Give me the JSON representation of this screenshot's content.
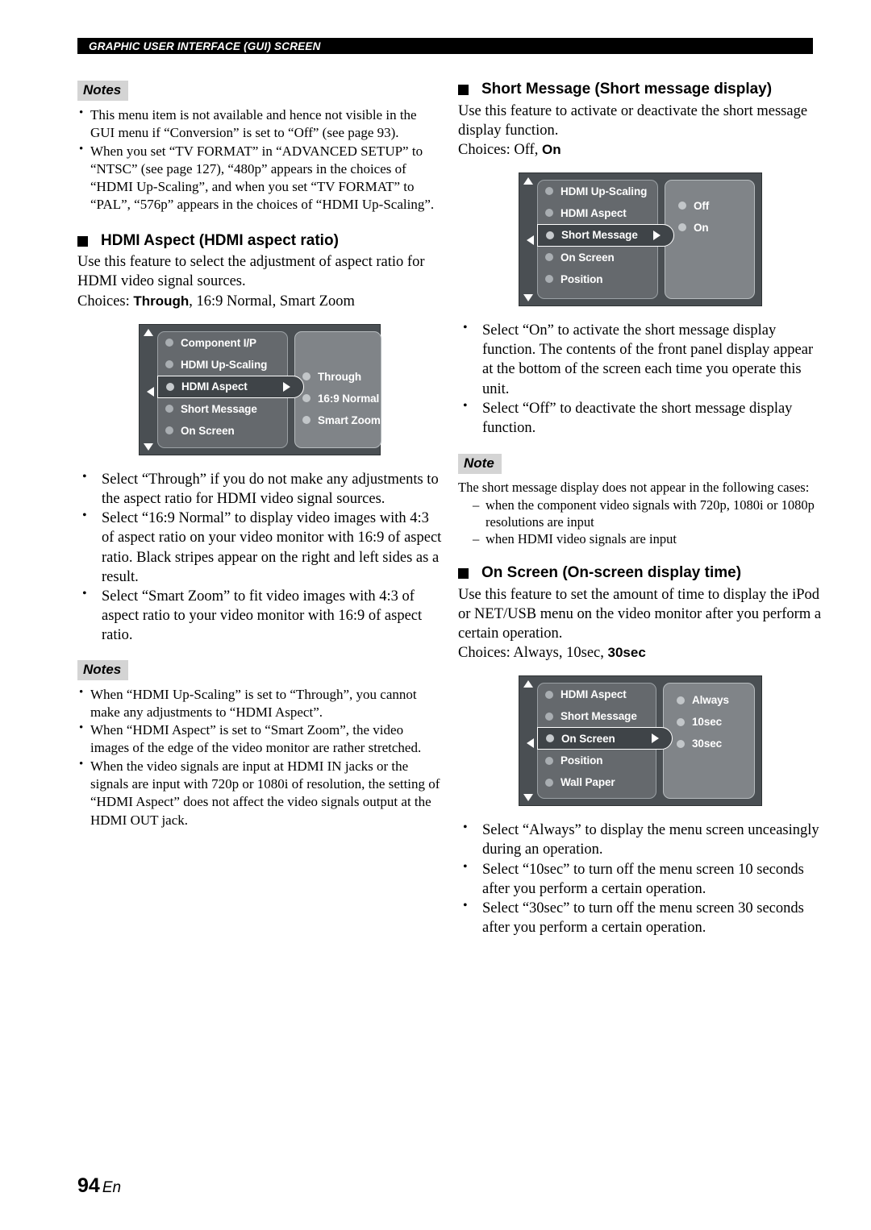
{
  "header": {
    "running_head": "GRAPHIC USER INTERFACE (GUI) SCREEN"
  },
  "footer": {
    "page_number": "94",
    "language": "En"
  },
  "labels": {
    "notes": "Notes",
    "note": "Note"
  },
  "left_column": {
    "notes_1": [
      "This menu item is not available and hence not visible in the GUI menu if “Conversion” is set to “Off” (see page 93).",
      "When you set “TV FORMAT” in “ADVANCED SETUP” to “NTSC” (see page 127), “480p” appears in the choices of “HDMI Up-Scaling”, and when you set “TV FORMAT” to “PAL”, “576p” appears in the choices of “HDMI Up-Scaling”."
    ],
    "section": {
      "heading": "HDMI Aspect (HDMI aspect ratio)",
      "description": "Use this feature to select the adjustment of aspect ratio for HDMI video signal sources.",
      "choices_label": "Choices:",
      "choices_bold": "Through",
      "choices_rest": ", 16:9 Normal, Smart Zoom"
    },
    "menu": {
      "left_items": [
        {
          "label": "Component I/P",
          "selected": false
        },
        {
          "label": "HDMI Up-Scaling",
          "selected": false
        },
        {
          "label": "HDMI Aspect",
          "selected": true
        },
        {
          "label": "Short Message",
          "selected": false
        },
        {
          "label": "On Screen",
          "selected": false
        }
      ],
      "right_items": [
        "Through",
        "16:9 Normal",
        "Smart Zoom"
      ],
      "scroll_up": "▲",
      "scroll_down": "▼"
    },
    "bullets": [
      "Select “Through” if you do not make any adjustments to the aspect ratio for HDMI video signal sources.",
      "Select “16:9 Normal” to display video images with 4:3 of aspect ratio on your video monitor with 16:9 of aspect ratio. Black stripes appear on the right and left sides as a result.",
      "Select “Smart Zoom” to fit video images with 4:3 of aspect ratio to your video monitor with 16:9 of aspect ratio."
    ],
    "notes_2": [
      "When “HDMI Up-Scaling” is set to “Through”, you cannot make any adjustments to “HDMI Aspect”.",
      "When “HDMI Aspect” is set to “Smart Zoom”, the video images of the edge of the video monitor are rather stretched.",
      "When the video signals are input at HDMI IN jacks or the signals are input with 720p or 1080i of resolution, the setting of “HDMI Aspect” does not affect the video signals output at the HDMI OUT jack."
    ]
  },
  "right_column": {
    "section_short_message": {
      "heading": "Short Message (Short message display)",
      "description": "Use this feature to activate or deactivate the short message display function.",
      "choices_label": "Choices: Off, ",
      "choices_bold": "On"
    },
    "menu_short_message": {
      "left_items": [
        {
          "label": "HDMI Up-Scaling",
          "selected": false
        },
        {
          "label": "HDMI Aspect",
          "selected": false
        },
        {
          "label": "Short Message",
          "selected": true
        },
        {
          "label": "On Screen",
          "selected": false
        },
        {
          "label": "Position",
          "selected": false
        }
      ],
      "right_items": [
        "Off",
        "On"
      ],
      "scroll_up": "▲",
      "scroll_down": "▼"
    },
    "bullets_short_message": [
      "Select “On” to activate the short message display function. The contents of the front panel display appear at the bottom of the screen each time you operate this unit.",
      "Select “Off” to deactivate the short message display function."
    ],
    "note_block": {
      "intro": "The short message display does not appear in the following cases:",
      "items": [
        "when the component video signals with 720p, 1080i or 1080p resolutions are input",
        "when HDMI video signals are input"
      ]
    },
    "section_on_screen": {
      "heading": "On Screen (On-screen display time)",
      "description": "Use this feature to set the amount of time to display the iPod or NET/USB menu on the video monitor after you perform a certain operation.",
      "choices_label": "Choices: Always, 10sec, ",
      "choices_bold": "30sec"
    },
    "menu_on_screen": {
      "left_items": [
        {
          "label": "HDMI Aspect",
          "selected": false
        },
        {
          "label": "Short Message",
          "selected": false
        },
        {
          "label": "On Screen",
          "selected": true
        },
        {
          "label": "Position",
          "selected": false
        },
        {
          "label": "Wall Paper",
          "selected": false
        }
      ],
      "right_items": [
        "Always",
        "10sec",
        "30sec"
      ],
      "scroll_up": "▲",
      "scroll_down": "▼"
    },
    "bullets_on_screen": [
      "Select “Always” to display the menu screen unceasingly during an operation.",
      "Select “10sec” to turn off the menu screen 10 seconds after you perform a certain operation.",
      "Select “30sec” to turn off the menu screen 30 seconds after you perform a certain operation."
    ]
  },
  "colors": {
    "header_bar": "#000000",
    "note_tag_bg": "#d4d4d4",
    "gui_frame": "#4a4f53",
    "gui_left_panel": "#65696d",
    "gui_right_panel": "#808488",
    "gui_selected_row": "#3f4448"
  }
}
